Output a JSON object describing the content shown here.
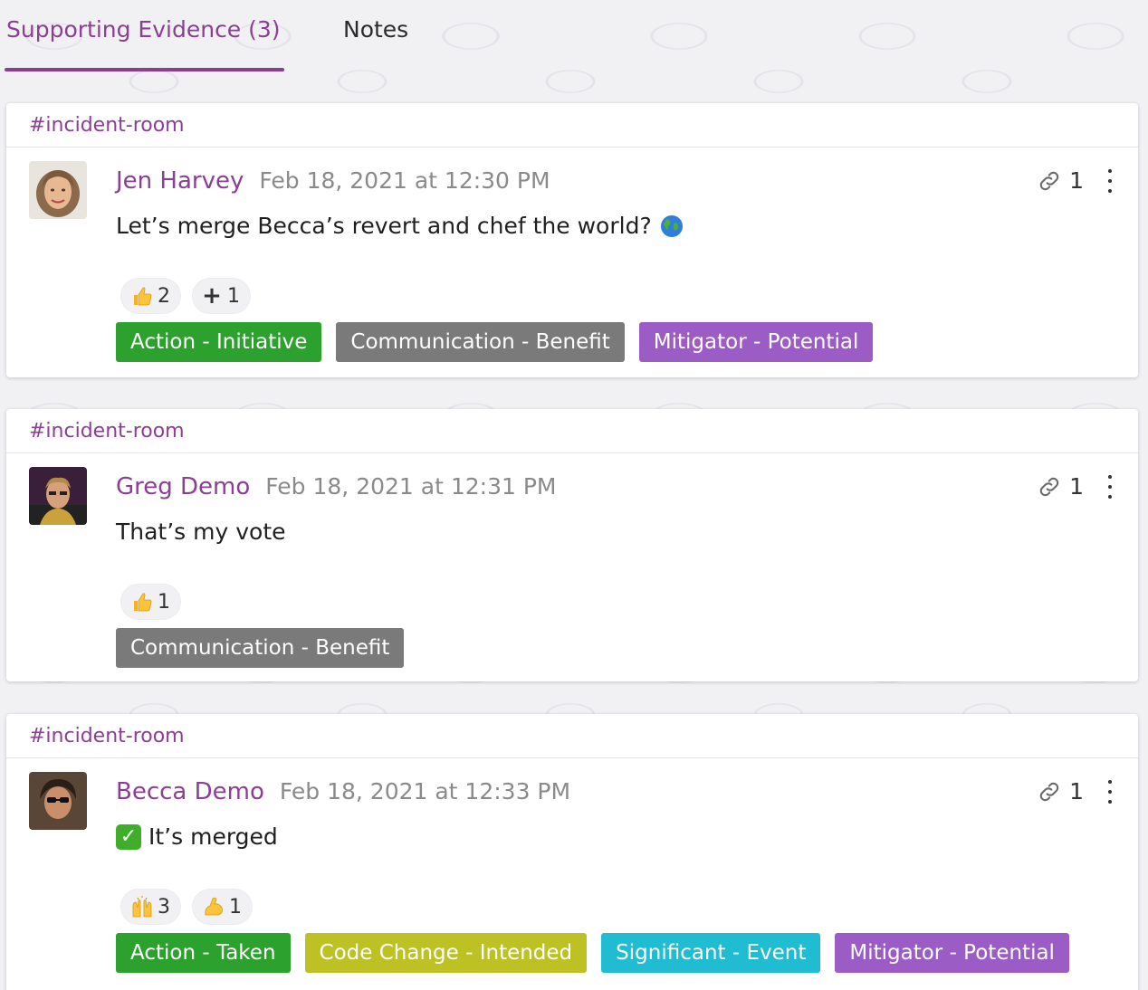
{
  "tabs": [
    {
      "label": "Supporting Evidence (3)"
    },
    {
      "label": "Notes"
    }
  ],
  "accent_color": "#8b3f94",
  "cards": [
    {
      "channel": "#incident-room",
      "author": "Jen Harvey",
      "time": "Feb 18, 2021 at 12:30 PM",
      "message": "Let’s merge Becca’s revert and chef the world?",
      "message_emoji": "globe-icon",
      "link_count": "1",
      "reactions": [
        {
          "icon": "thumbs-up-icon",
          "count": "2"
        },
        {
          "icon": "plus-icon",
          "count": "1"
        }
      ],
      "tags": [
        {
          "label": "Action - Initiative",
          "color": "#2da12e"
        },
        {
          "label": "Communication - Benefit",
          "color": "#7a7a7a"
        },
        {
          "label": "Mitigator - Potential",
          "color": "#9b5cc5"
        }
      ]
    },
    {
      "channel": "#incident-room",
      "author": "Greg Demo",
      "time": "Feb 18, 2021 at 12:31 PM",
      "message": "That’s my vote",
      "link_count": "1",
      "reactions": [
        {
          "icon": "thumbs-up-icon",
          "count": "1"
        }
      ],
      "tags": [
        {
          "label": "Communication - Benefit",
          "color": "#7a7a7a"
        }
      ]
    },
    {
      "channel": "#incident-room",
      "author": "Becca Demo",
      "time": "Feb 18, 2021 at 12:33 PM",
      "message": "It’s merged",
      "message_prefix_icon": "check-mark-icon",
      "link_count": "1",
      "reactions": [
        {
          "icon": "raised-hands-icon",
          "count": "3"
        },
        {
          "icon": "flexed-biceps-icon",
          "count": "1"
        }
      ],
      "tags": [
        {
          "label": "Action - Taken",
          "color": "#2da12e"
        },
        {
          "label": "Code Change - Intended",
          "color": "#bec124"
        },
        {
          "label": "Significant - Event",
          "color": "#1fbcd2"
        },
        {
          "label": "Mitigator - Potential",
          "color": "#9b5cc5"
        }
      ]
    }
  ]
}
